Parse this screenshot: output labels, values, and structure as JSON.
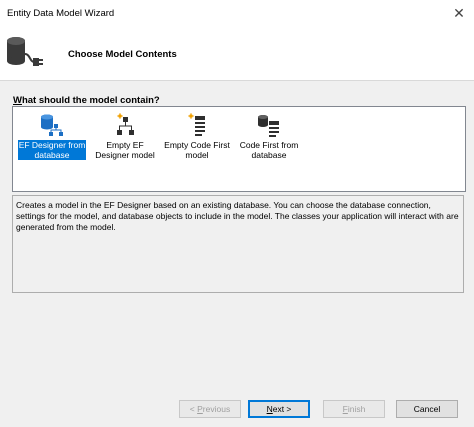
{
  "window": {
    "title": "Entity Data Model Wizard"
  },
  "header": {
    "title": "Choose Model Contents",
    "icon": "database-plug-icon"
  },
  "question": {
    "underlined_letter": "W",
    "rest": "hat should the model contain?"
  },
  "choices": [
    {
      "line1": "EF Designer from",
      "line2": "database",
      "selected": true,
      "icon": "ef-designer-database-icon"
    },
    {
      "line1": "Empty EF",
      "line2": "Designer model",
      "selected": false,
      "icon": "empty-ef-designer-icon"
    },
    {
      "line1": "Empty Code First",
      "line2": "model",
      "selected": false,
      "icon": "empty-code-first-icon"
    },
    {
      "line1": "Code First from",
      "line2": "database",
      "selected": false,
      "icon": "code-first-database-icon"
    }
  ],
  "description": "Creates a model in the EF Designer based on an existing database. You can choose the database connection, settings for the model, and database objects to include in the model. The classes your application will interact with are generated from the model.",
  "buttons": {
    "previous": {
      "pre": "< ",
      "u": "P",
      "post": "revious",
      "enabled": false
    },
    "next": {
      "pre": "",
      "u": "N",
      "post": "ext >",
      "enabled": true
    },
    "finish": {
      "pre": "",
      "u": "F",
      "post": "inish",
      "enabled": false
    },
    "cancel": {
      "label": "Cancel",
      "enabled": true
    }
  },
  "colors": {
    "selection": "#0078d7",
    "panel": "#f0f0f0"
  }
}
